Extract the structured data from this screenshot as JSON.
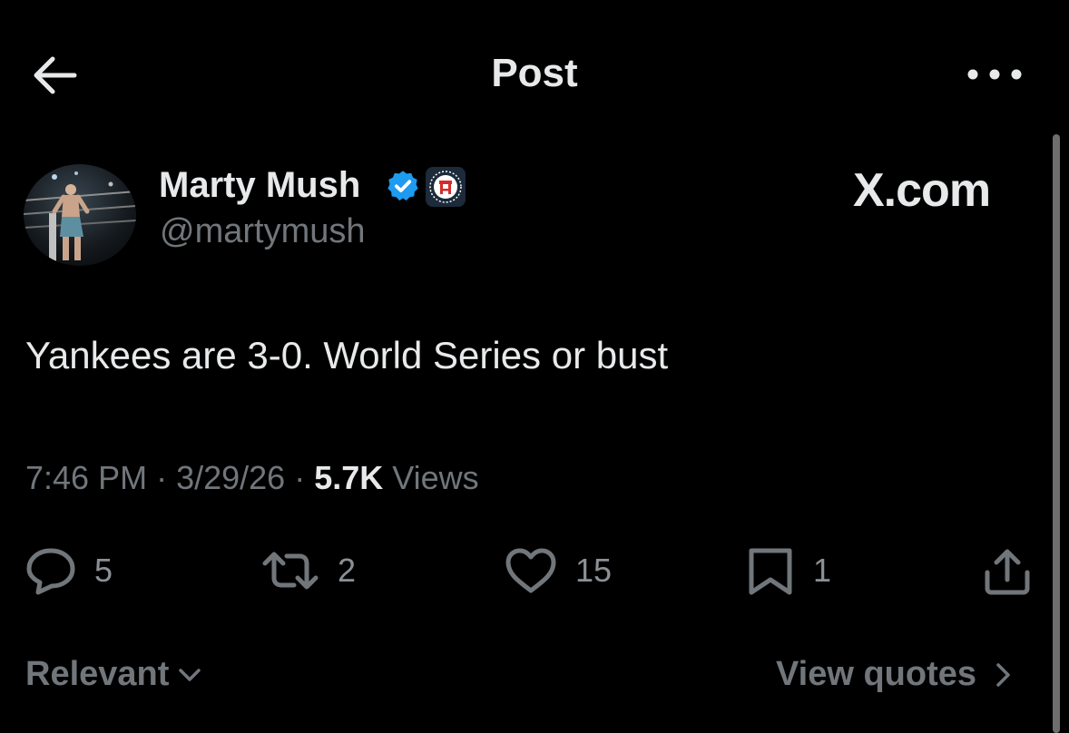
{
  "header": {
    "title": "Post",
    "back_icon": "back-arrow-icon",
    "more_icon": "more-options-icon"
  },
  "author": {
    "display_name": "Marty Mush",
    "handle": "@martymush",
    "verified_icon": "verified-badge-icon",
    "affiliate_icon": "barstool-affiliate-icon",
    "verified_color": "#1d9bf0"
  },
  "watermark": "X.com",
  "post": {
    "text": "Yankees are 3-0. World Series or bust",
    "time": "7:46 PM",
    "date": "3/29/26",
    "views_count": "5.7K",
    "views_label": "Views"
  },
  "actions": {
    "replies": "5",
    "reposts": "2",
    "likes": "15",
    "bookmarks": "1"
  },
  "footer": {
    "sort_label": "Relevant",
    "view_quotes_label": "View quotes"
  },
  "colors": {
    "background": "#000000",
    "primary_text": "#e7e9ea",
    "secondary_text": "#71767b"
  }
}
